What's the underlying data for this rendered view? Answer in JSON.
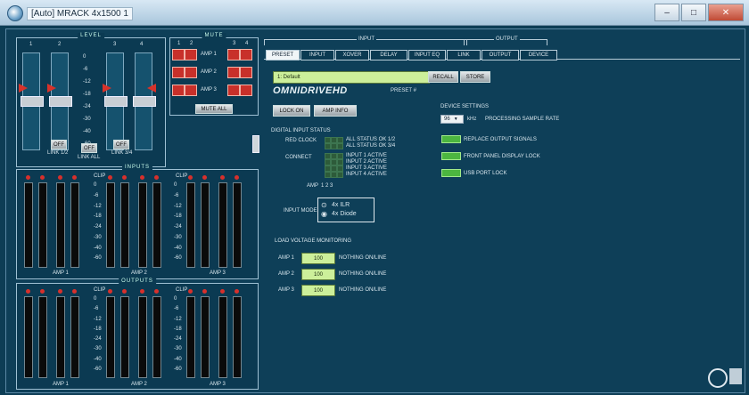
{
  "window": {
    "title": "[Auto] MRACK 4x1500 1",
    "min": "–",
    "max": "□",
    "close": "✕"
  },
  "level": {
    "title": "LEVEL",
    "channels": [
      "1",
      "2",
      "3",
      "4"
    ]
  },
  "mute": {
    "title": "MUTE",
    "amps": [
      "AMP 1",
      "AMP 2",
      "AMP 3"
    ],
    "mute_all": "MUTE ALL",
    "cols": [
      "1",
      "2",
      "3",
      "4"
    ]
  },
  "buttons": {
    "link_12": "OFF",
    "link_all": "OFF",
    "link_34": "OFF"
  },
  "fader_labels": {
    "link12": "LINK 1/2",
    "link_all": "LINK ALL",
    "link34": "LINK 3/4"
  },
  "inputs_meter": {
    "title": "INPUTS",
    "clip": "CLIP",
    "amps": [
      "AMP 1",
      "AMP 2",
      "AMP 3"
    ]
  },
  "outputs_meter": {
    "title": "OUTPUTS",
    "clip": "CLIP",
    "amps": [
      "AMP 1",
      "AMP 2",
      "AMP 3"
    ]
  },
  "scale_ticks": [
    "0",
    "-6",
    "-12",
    "-18",
    "-24",
    "-30",
    "-40",
    "-60"
  ],
  "group_labels": {
    "input": "INPUT",
    "output": "OUTPUT"
  },
  "tabs": [
    "PRESET",
    "INPUT",
    "XOVER",
    "DELAY",
    "INPUT EQ",
    "LINK",
    "OUTPUT",
    "DEVICE"
  ],
  "preset": {
    "name": "1: Default",
    "recall": "RECALL",
    "store": "STORE",
    "brand": "OMNIDRIVEHD",
    "preset_label": "PRESET #",
    "lock_on": "LOCK ON",
    "amp_info": "AMP INFO"
  },
  "digital": {
    "title": "DIGITAL INPUT STATUS",
    "row1_label": "RED CLOCK",
    "status_lines": [
      "ALL STATUS OK 1/2",
      "ALL STATUS OK 3/4"
    ],
    "row2_label": "CONNECT",
    "input_lines": [
      "INPUT 1 ACTIVE",
      "INPUT 2 ACTIVE",
      "INPUT 3 ACTIVE",
      "INPUT 4 ACTIVE"
    ],
    "amp_label": "AMP",
    "amp_nums": "1  2  3",
    "input_mode": "INPUT MODE",
    "mode_a": "4x ILR",
    "mode_b": "4x Diode"
  },
  "device": {
    "title": "DEVICE SETTINGS",
    "rate": "96",
    "rate_unit": "kHz",
    "rate_label": "PROCESSING SAMPLE RATE",
    "opt1": "REPLACE OUTPUT SIGNALS",
    "opt2": "FRONT PANEL DISPLAY LOCK",
    "opt3": "USB PORT LOCK"
  },
  "load": {
    "title": "LOAD VOLTAGE MONITORING",
    "rows": [
      {
        "label": "AMP 1",
        "value": "100",
        "unit": "NOTHING ON/LINE"
      },
      {
        "label": "AMP 2",
        "value": "100",
        "unit": "NOTHING ON/LINE"
      },
      {
        "label": "AMP 3",
        "value": "100",
        "unit": "NOTHING ON/LINE"
      }
    ]
  },
  "colors": {
    "accent": "#ccef9a",
    "led_on": "#4cb640",
    "mute_red": "#c8302a",
    "background": "#0d3d55"
  },
  "icons": {
    "app": "speaker-app-icon",
    "logo": "seal-logo-icon"
  }
}
